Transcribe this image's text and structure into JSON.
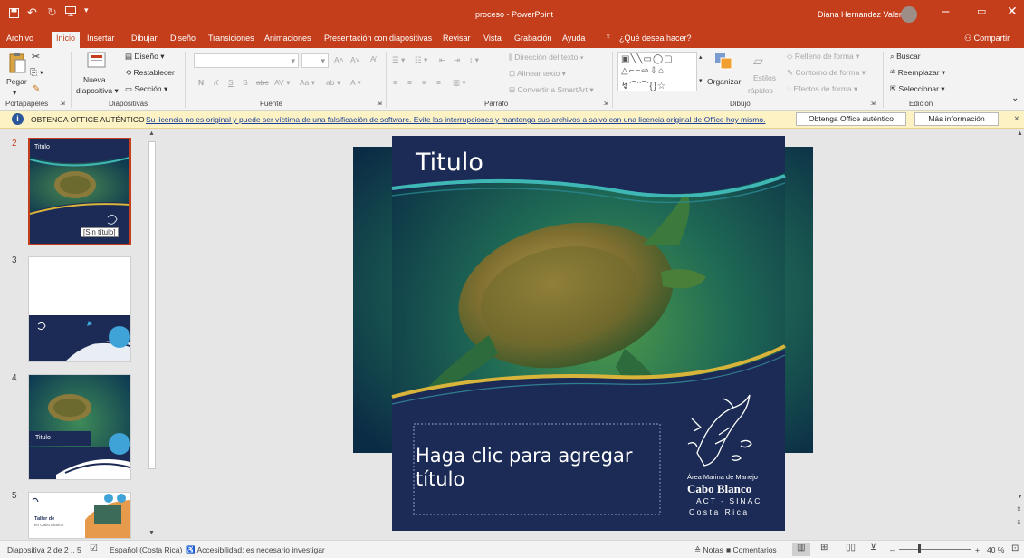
{
  "window": {
    "title": "proceso - PowerPoint",
    "user": "Diana Hernandez Valerio"
  },
  "tabs": [
    "Archivo",
    "Inicio",
    "Insertar",
    "Dibujar",
    "Diseño",
    "Transiciones",
    "Animaciones",
    "Presentación con diapositivas",
    "Revisar",
    "Vista",
    "Grabación",
    "Ayuda"
  ],
  "tellme": "¿Qué desea hacer?",
  "share": "Compartir",
  "ribbon": {
    "clipboard": {
      "paste": "Pegar",
      "label": "Portapapeles"
    },
    "slides": {
      "new_line1": "Nueva",
      "new_line2": "diapositiva",
      "layout": "Diseño",
      "reset": "Restablecer",
      "section": "Sección",
      "label": "Diapositivas"
    },
    "font": {
      "label": "Fuente",
      "bold": "N",
      "italic": "K",
      "underline": "S",
      "strike": "S"
    },
    "paragraph": {
      "text_dir": "Dirección del texto",
      "align_text": "Alinear texto",
      "smartart": "Convertir a SmartArt",
      "label": "Párrafo"
    },
    "drawing": {
      "arrange": "Organizar",
      "styles_line1": "Estilos",
      "styles_line2": "rápidos",
      "fill": "Relleno de forma",
      "outline": "Contorno de forma",
      "effects": "Efectos de forma",
      "label": "Dibujo"
    },
    "editing": {
      "find": "Buscar",
      "replace": "Reemplazar",
      "select": "Seleccionar",
      "label": "Edición"
    }
  },
  "notice": {
    "title": "OBTENGA OFFICE AUTÉNTICO",
    "message": "Su licencia no es original y puede ser víctima de una falsificación de software. Evite las interrupciones y mantenga sus archivos a salvo con una licencia original de Office hoy mismo.",
    "btn_get": "Obtenga Office auténtico",
    "btn_more": "Más información"
  },
  "thumbnails": [
    {
      "num": "2",
      "title": "Titulo",
      "tooltip": "[Sin título]"
    },
    {
      "num": "3"
    },
    {
      "num": "4",
      "title": "Titulo"
    },
    {
      "num": "5",
      "title": "Taller de",
      "subtitle": "en Cabo Blanco"
    }
  ],
  "slide": {
    "title": "Titulo",
    "placeholder": "Haga clic para agregar título",
    "logo_small": "Área Marina de Manejo",
    "logo_name": "Cabo Blanco",
    "logo_line3": "ACT - SINAC",
    "logo_line4": "Costa Rica"
  },
  "status": {
    "slide": "Diapositiva 2 de 2 .. 5",
    "language": "Español (Costa Rica)",
    "accessibility": "Accesibilidad: es necesario investigar",
    "notes": "Notas",
    "comments": "Comentarios",
    "zoom": "40 %"
  },
  "colors": {
    "accent": "#c43e1c",
    "slide_navy": "#1b2b55",
    "wave_teal": "#3fb7b5",
    "wave_gold": "#d9b43a"
  }
}
